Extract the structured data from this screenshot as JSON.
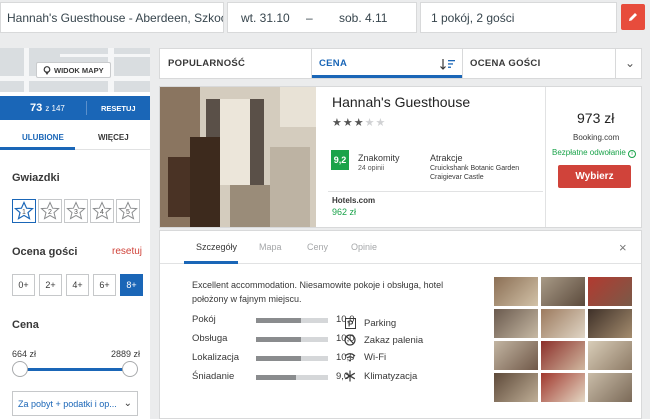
{
  "search": {
    "destination": "Hannah's Guesthouse - Aberdeen, Szkocja",
    "checkin": "wt. 31.10",
    "date_separator": "–",
    "checkout": "sob. 4.11",
    "guests": "1 pokój, 2 gości"
  },
  "sidebar": {
    "map_button": "WIDOK MAPY",
    "count": "73",
    "count_total": "z 147",
    "reset": "RESETUJ",
    "tabs": [
      "ULUBIONE",
      "WIĘCEJ"
    ],
    "stars_title": "Gwiazdki",
    "star_levels": [
      "1",
      "2",
      "3",
      "4",
      "5"
    ],
    "rating_title": "Ocena gości",
    "rating_reset": "resetuj",
    "rating_options": [
      "0+",
      "2+",
      "4+",
      "6+",
      "8+"
    ],
    "rating_selected": "8+",
    "price_title": "Cena",
    "price_min": "664 zł",
    "price_max": "2889 zł",
    "price_select": "Za pobyt + podatki i op..."
  },
  "sort": {
    "items": [
      "POPULARNOŚĆ",
      "CENA",
      "OCENA GOŚCI"
    ],
    "active": "CENA"
  },
  "hotel": {
    "name": "Hannah's Guesthouse",
    "stars": 3,
    "stars_max": 5,
    "score": "9,2",
    "score_label": "Znakomity",
    "score_count": "24 opinii",
    "attractions_title": "Atrakcje",
    "attractions": [
      "Cruickshank Botanic Garden",
      "Craigievar Castle"
    ],
    "deal_source": "Hotels.com",
    "deal_price": "962 zł",
    "price": "973 zł",
    "provider": "Booking.com",
    "cancellation": "Bezpłatne odwołanie",
    "choose_button": "Wybierz"
  },
  "details": {
    "tabs": [
      "Szczegóły",
      "Mapa",
      "Ceny",
      "Opinie"
    ],
    "active_tab": "Szczegóły",
    "description": "Excellent accommodation. Niesamowite pokoje i obsługa, hotel położony w fajnym miejscu.",
    "ratings": [
      {
        "label": "Pokój",
        "value": "10,0",
        "score": 10.0
      },
      {
        "label": "Obsługa",
        "value": "10,0",
        "score": 10.0
      },
      {
        "label": "Lokalizacja",
        "value": "10,0",
        "score": 10.0
      },
      {
        "label": "Śniadanie",
        "value": "9,0",
        "score": 9.0
      }
    ],
    "amenities": [
      {
        "label": "Parking",
        "icon": "parking-icon"
      },
      {
        "label": "Zakaz palenia",
        "icon": "no-smoking-icon"
      },
      {
        "label": "Wi-Fi",
        "icon": "wifi-icon"
      },
      {
        "label": "Klimatyzacja",
        "icon": "air-conditioning-icon"
      }
    ]
  },
  "colors": {
    "brand_blue": "#1a66b7",
    "accent_red": "#d0433a",
    "score_green": "#1aa34a"
  }
}
